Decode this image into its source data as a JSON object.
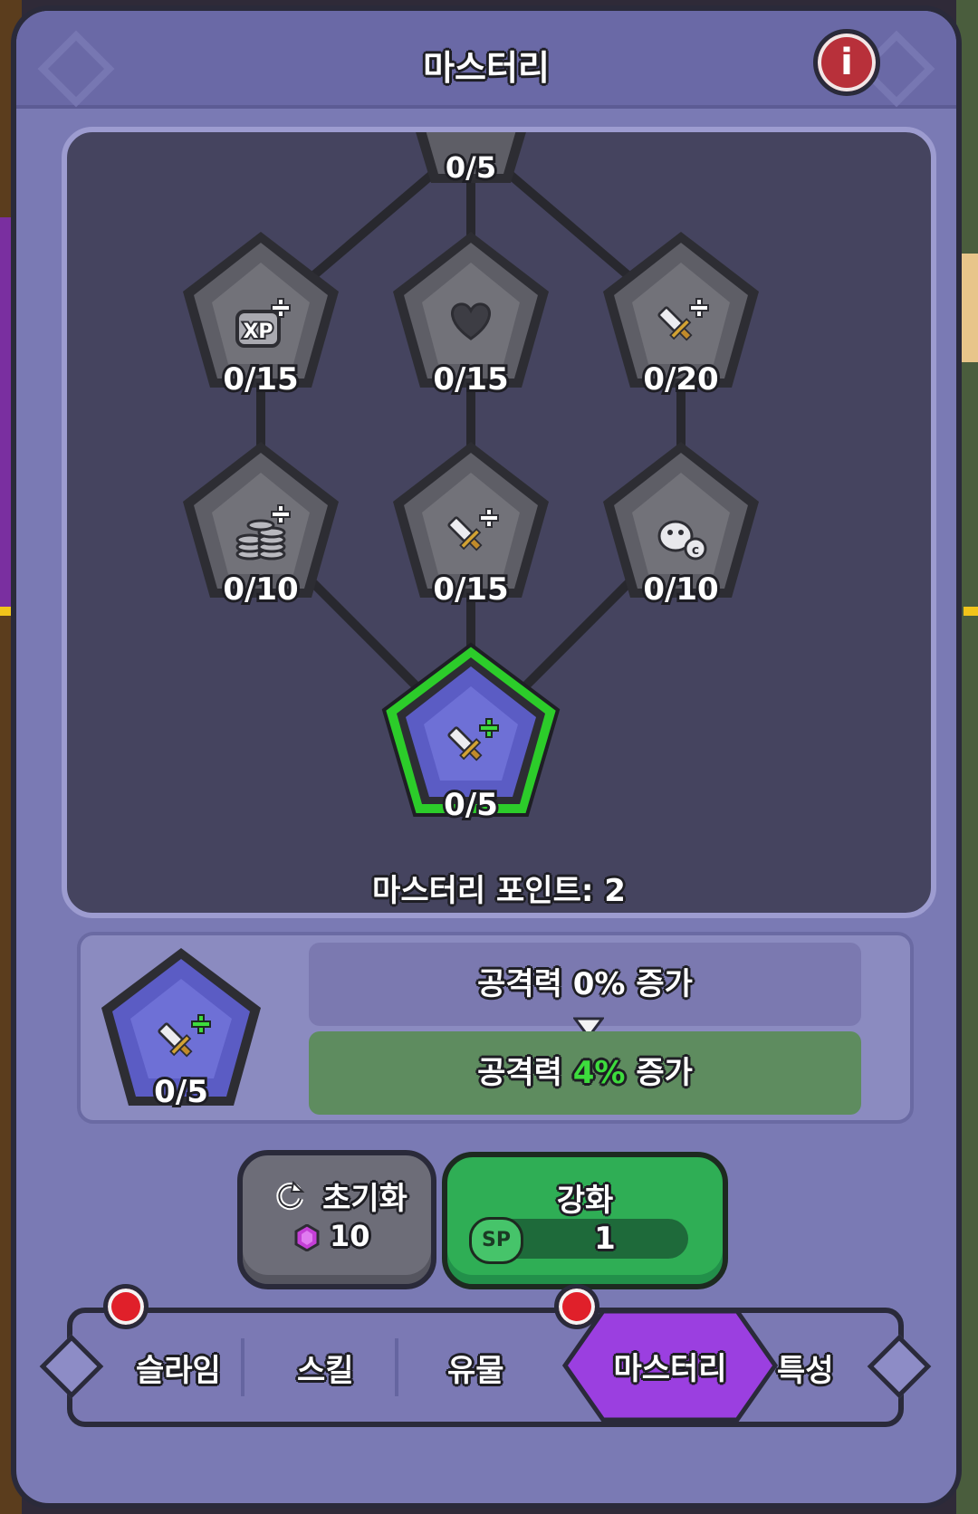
{
  "header": {
    "title": "마스터리",
    "info_icon": "info-icon"
  },
  "tree": {
    "nodes": [
      {
        "id": "top",
        "icon": "unknown-icon",
        "level": "0/5"
      },
      {
        "id": "xp",
        "icon": "xp-plus-icon",
        "level": "0/15"
      },
      {
        "id": "heart",
        "icon": "heart-icon",
        "level": "0/15"
      },
      {
        "id": "sword-a",
        "icon": "sword-plus-icon",
        "level": "0/20"
      },
      {
        "id": "coins",
        "icon": "coins-plus-icon",
        "level": "0/10"
      },
      {
        "id": "sword-b",
        "icon": "sword-plus-icon",
        "level": "0/15"
      },
      {
        "id": "slime",
        "icon": "slime-coin-icon",
        "level": "0/10"
      },
      {
        "id": "sword-selected",
        "icon": "sword-plus-icon",
        "level": "0/5",
        "selected": true
      }
    ],
    "points_text": "마스터리 포인트: 2"
  },
  "detail": {
    "level": "0/5",
    "current": {
      "prefix": "공격력 ",
      "value": "0%",
      "suffix": " 증가"
    },
    "next": {
      "prefix": "공격력 ",
      "value": "4%",
      "suffix": " 증가"
    }
  },
  "buttons": {
    "reset": {
      "label": "초기화",
      "cost": "10",
      "icon": "refresh-icon",
      "currency_icon": "gem-icon"
    },
    "upgrade": {
      "label": "강화",
      "currency": "SP",
      "cost": "1"
    }
  },
  "nav": {
    "items": [
      {
        "label": "슬라임",
        "badge": true
      },
      {
        "label": "스킬",
        "badge": false
      },
      {
        "label": "유물",
        "badge": false
      },
      {
        "label": "마스터리",
        "badge": true,
        "active": true
      },
      {
        "label": "특성",
        "badge": false
      }
    ]
  },
  "colors": {
    "panel": "#7a7ab4",
    "tree_bg": "#45445f",
    "node_locked": "#5e5e66",
    "node_selected": "#5b5cc4",
    "selected_glow": "#38d12e",
    "upgrade_green": "#2fae55",
    "highlight_green": "#3ddc3d",
    "nav_active": "#9b3fe0",
    "badge_red": "#e0202a"
  }
}
